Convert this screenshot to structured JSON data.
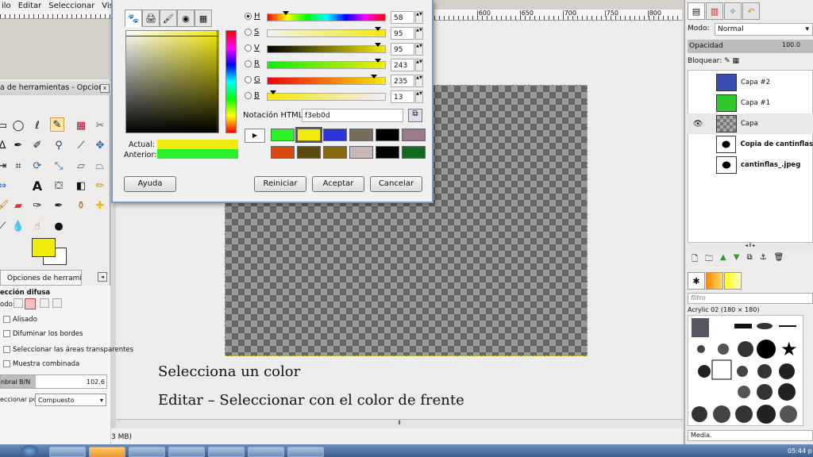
{
  "menu": {
    "items": [
      "ilo",
      "Editar",
      "Seleccionar",
      "Vista"
    ]
  },
  "ruler": {
    "ticks": [
      "|600",
      "|650",
      "|700",
      "|750",
      "|800"
    ]
  },
  "toolbox": {
    "title": "a de herramientas - Opcion...",
    "close": "x",
    "tools": [
      "rect-select",
      "ellipse-select",
      "free-select",
      "fuzzy-select",
      "by-color-select",
      "scissors",
      "foreground-select",
      "paths",
      "color-picker",
      "zoom",
      "measure",
      "move",
      "align",
      "crop",
      "rotate",
      "scale",
      "shear",
      "perspective",
      "flip",
      "text",
      "bucket-fill",
      "blend",
      "pencil",
      "paintbrush",
      "eraser",
      "airbrush",
      "ink",
      "clone",
      "heal",
      "perspective-clone",
      "blur",
      "smudge",
      "dodge"
    ],
    "fg_color": "#f3eb0d",
    "bg_color": "#ffffff"
  },
  "tool_options": {
    "tab_label": "Opciones de herramienta",
    "heading": "ección difusa",
    "mode_label": "odo:",
    "options": [
      "Alisado",
      "Difuminar los bordes",
      "Seleccionar las áreas transparentes",
      "Muestra combinada"
    ],
    "threshold_label": "nbral B/N",
    "threshold_value": "102.6",
    "select_by_label": "eccionar por:",
    "select_by_value": "Compuesto"
  },
  "color_dialog": {
    "channels": [
      {
        "key": "H",
        "value": "58",
        "selected": true,
        "marker": 0.16
      },
      {
        "key": "S",
        "value": "95",
        "selected": false,
        "marker": 0.95
      },
      {
        "key": "V",
        "value": "95",
        "selected": false,
        "marker": 0.95
      },
      {
        "key": "R",
        "value": "243",
        "selected": false,
        "marker": 0.95
      },
      {
        "key": "G",
        "value": "235",
        "selected": false,
        "marker": 0.92
      },
      {
        "key": "B",
        "value": "13",
        "selected": false,
        "marker": 0.05
      }
    ],
    "html_label": "Notación HTML:",
    "html_value": "f3eb0d",
    "actual_label": "Actual:",
    "previous_label": "Anterior:",
    "current_color": "#f3eb0d",
    "previous_color": "#2df02d",
    "history_colors": [
      "#2df02d",
      "#f3eb0d",
      "#2b35d8",
      "#786c5a",
      "#000000",
      "#9a7a8c",
      "#d84a10",
      "#5a4a10",
      "#8a6a10",
      "#c8b8b8",
      "#000000",
      "#106a20"
    ],
    "buttons": {
      "help": "Ayuda",
      "reset": "Reiniciar",
      "ok": "Aceptar",
      "cancel": "Cancelar"
    }
  },
  "canvas": {
    "caption1": "Selecciona un color",
    "caption2": "Editar – Seleccionar con el color de frente",
    "status": "3 MB)"
  },
  "layers": {
    "mode_label": "Modo:",
    "mode_value": "Normal",
    "opacity_label": "Opacidad",
    "opacity_value": "100.0",
    "lock_label": "Bloquear:",
    "items": [
      {
        "name": "Capa #2",
        "visible": false,
        "bold": false
      },
      {
        "name": "Capa #1",
        "visible": false,
        "bold": false
      },
      {
        "name": "Capa",
        "visible": true,
        "bold": false
      },
      {
        "name": "Copia de cantinflas",
        "visible": false,
        "bold": true
      },
      {
        "name": "cantinflas_.jpeg",
        "visible": false,
        "bold": true
      }
    ]
  },
  "brushes": {
    "filter_placeholder": "filtro",
    "current": "Acrylic 02 (180 × 180)",
    "media_label": "Media."
  },
  "taskbar": {
    "clock": "05:44 p"
  }
}
